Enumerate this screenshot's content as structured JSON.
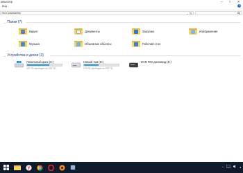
{
  "window": {
    "title": "мпьютер",
    "minimize_glyph": "─",
    "maximize_glyph": "□",
    "close_glyph": "✕"
  },
  "ribbon": {
    "tab_view": "Вид",
    "help_glyph": "?"
  },
  "address": {
    "path": "Этот компьютер",
    "chevron": "⌄",
    "refresh_glyph": "↻",
    "search_placeholder": "",
    "search_icon": "search-icon"
  },
  "folders_group": {
    "header": "Папки (7)",
    "chevron": "⌄",
    "items": [
      {
        "label": "Видео",
        "icon": "video-folder-icon"
      },
      {
        "label": "Документы",
        "icon": "documents-folder-icon"
      },
      {
        "label": "Загрузки",
        "icon": "downloads-folder-icon"
      },
      {
        "label": "Изображения",
        "icon": "pictures-folder-icon"
      },
      {
        "label": "Музыка",
        "icon": "music-folder-icon"
      },
      {
        "label": "Объемные объекты",
        "icon": "3d-objects-folder-icon"
      },
      {
        "label": "Рабочий стол",
        "icon": "desktop-folder-icon"
      }
    ]
  },
  "devices_group": {
    "header": "Устройства и диски (3)",
    "chevron": "⌄",
    "drives": [
      {
        "name": "Локальный диск (C:)",
        "free": "107 ГБ свободно из 297 ГБ",
        "used_fraction": 0.64,
        "icon": "windows-drive-icon"
      },
      {
        "name": "Новый том (D:)",
        "free": "174 ГБ свободно из 297 ГБ",
        "used_fraction": 0.41,
        "icon": "hard-drive-icon"
      },
      {
        "name": "DVD RW дисковод (E:)",
        "free": "",
        "used_fraction": null,
        "icon": "dvd-drive-icon"
      }
    ]
  },
  "taskbar": {
    "items": [
      "start-icon",
      "file-explorer-icon",
      "yandex-browser-icon",
      "chrome-icon",
      "opera-icon",
      "media-icon",
      "app-icon"
    ],
    "tray_chevron": "^",
    "tray_lang_glyph": "◂"
  },
  "colors": {
    "accent": "#26a0da",
    "folder": "#f6d36b",
    "header_text": "#1e3a78",
    "taskbar": "#0f1a2b"
  }
}
